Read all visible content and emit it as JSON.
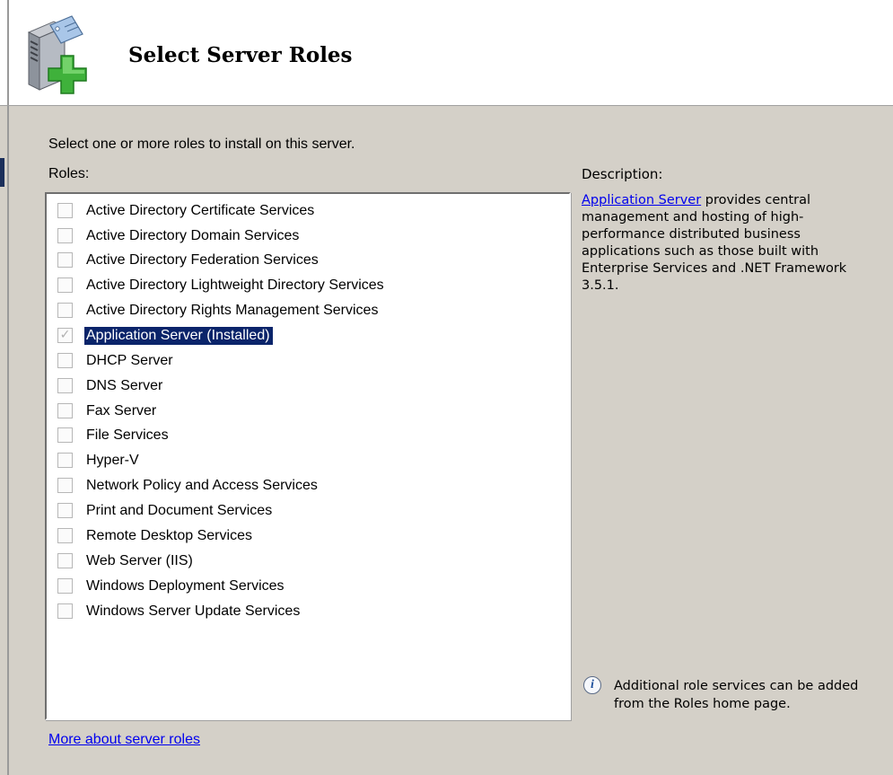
{
  "header": {
    "title": "Select Server Roles",
    "icon": "server-add-icon"
  },
  "instruction": "Select one or more roles to install on this server.",
  "roles_label": "Roles:",
  "roles": [
    {
      "label": "Active Directory Certificate Services",
      "checked": false
    },
    {
      "label": "Active Directory Domain Services",
      "checked": false
    },
    {
      "label": "Active Directory Federation Services",
      "checked": false
    },
    {
      "label": "Active Directory Lightweight Directory Services",
      "checked": false
    },
    {
      "label": "Active Directory Rights Management Services",
      "checked": false
    },
    {
      "label": "Application Server  (Installed)",
      "checked": true,
      "disabled": true,
      "selected": true
    },
    {
      "label": "DHCP Server",
      "checked": false
    },
    {
      "label": "DNS Server",
      "checked": false
    },
    {
      "label": "Fax Server",
      "checked": false
    },
    {
      "label": "File Services",
      "checked": false
    },
    {
      "label": "Hyper-V",
      "checked": false
    },
    {
      "label": "Network Policy and Access Services",
      "checked": false
    },
    {
      "label": "Print and Document Services",
      "checked": false
    },
    {
      "label": "Remote Desktop Services",
      "checked": false
    },
    {
      "label": "Web Server (IIS)",
      "checked": false
    },
    {
      "label": "Windows Deployment Services",
      "checked": false
    },
    {
      "label": "Windows Server Update Services",
      "checked": false
    }
  ],
  "description": {
    "label": "Description:",
    "link_text": "Application Server",
    "text": " provides central management and hosting of high-performance distributed business applications such as those built with Enterprise Services and .NET Framework 3.5.1."
  },
  "note": {
    "icon": "info-icon",
    "text": "Additional role services can be added from the Roles home page."
  },
  "more_link": "More about server roles",
  "colors": {
    "background": "#d4d0c8",
    "selection": "#0a246a",
    "link": "#0000ee"
  }
}
